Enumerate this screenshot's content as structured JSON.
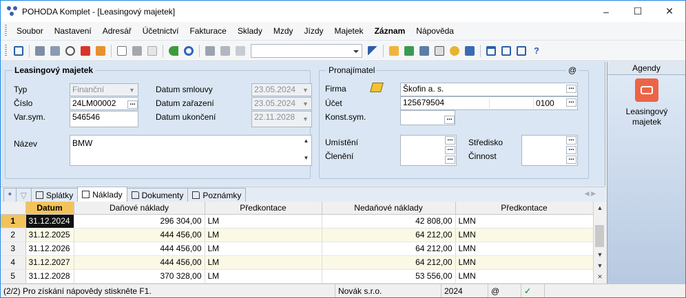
{
  "window": {
    "title": "POHODA Komplet - [Leasingový majetek]"
  },
  "menu": [
    "Soubor",
    "Nastavení",
    "Adresář",
    "Účetnictví",
    "Fakturace",
    "Sklady",
    "Mzdy",
    "Jízdy",
    "Majetek",
    "Záznam",
    "Nápověda"
  ],
  "menu_bold_index": 9,
  "form": {
    "section_title": "Leasingový majetek",
    "typ_label": "Typ",
    "typ_value": "Finanční",
    "cislo_label": "Číslo",
    "cislo_value": "24LM00002",
    "varsym_label": "Var.sym.",
    "varsym_value": "546546",
    "datum_smlouvy_label": "Datum smlouvy",
    "datum_smlouvy_value": "23.05.2024",
    "datum_zarazeni_label": "Datum zařazení",
    "datum_zarazeni_value": "23.05.2024",
    "datum_ukonceni_label": "Datum ukončení",
    "datum_ukonceni_value": "22.11.2028",
    "nazev_label": "Název",
    "nazev_value": "BMW"
  },
  "pronajimatel": {
    "title": "Pronajímatel",
    "at_symbol": "@",
    "firma_label": "Firma",
    "firma_value": "Škofin a. s.",
    "ucet_label": "Účet",
    "ucet_value": "125679504",
    "ucet_bank": "0100",
    "konstsym_label": "Konst.sym.",
    "umisteni_label": "Umístění",
    "cleneni_label": "Členění",
    "stredisko_label": "Středisko",
    "cinnost_label": "Činnost"
  },
  "agendy": {
    "header": "Agendy",
    "item_label": "Leasingový majetek"
  },
  "tabs": [
    {
      "label": "*"
    },
    {
      "label": "Splátky"
    },
    {
      "label": "Náklady"
    },
    {
      "label": "Dokumenty"
    },
    {
      "label": "Poznámky"
    }
  ],
  "grid": {
    "columns": [
      "Datum",
      "Daňové náklady",
      "Předkontace",
      "Nedaňové náklady",
      "Předkontace"
    ],
    "rows": [
      {
        "n": "1",
        "datum": "31.12.2024",
        "danove": "296 304,00",
        "pred1": "LM",
        "nedanove": "42 808,00",
        "pred2": "LMN"
      },
      {
        "n": "2",
        "datum": "31.12.2025",
        "danove": "444 456,00",
        "pred1": "LM",
        "nedanove": "64 212,00",
        "pred2": "LMN"
      },
      {
        "n": "3",
        "datum": "31.12.2026",
        "danove": "444 456,00",
        "pred1": "LM",
        "nedanove": "64 212,00",
        "pred2": "LMN"
      },
      {
        "n": "4",
        "datum": "31.12.2027",
        "danove": "444 456,00",
        "pred1": "LM",
        "nedanove": "64 212,00",
        "pred2": "LMN"
      },
      {
        "n": "5",
        "datum": "31.12.2028",
        "danove": "370 328,00",
        "pred1": "LM",
        "nedanove": "53 556,00",
        "pred2": "LMN"
      }
    ]
  },
  "status": {
    "help": "(2/2) Pro získání nápovědy stiskněte F1.",
    "company": "Novák s.r.o.",
    "year": "2024",
    "at": "@",
    "check": "✓"
  }
}
